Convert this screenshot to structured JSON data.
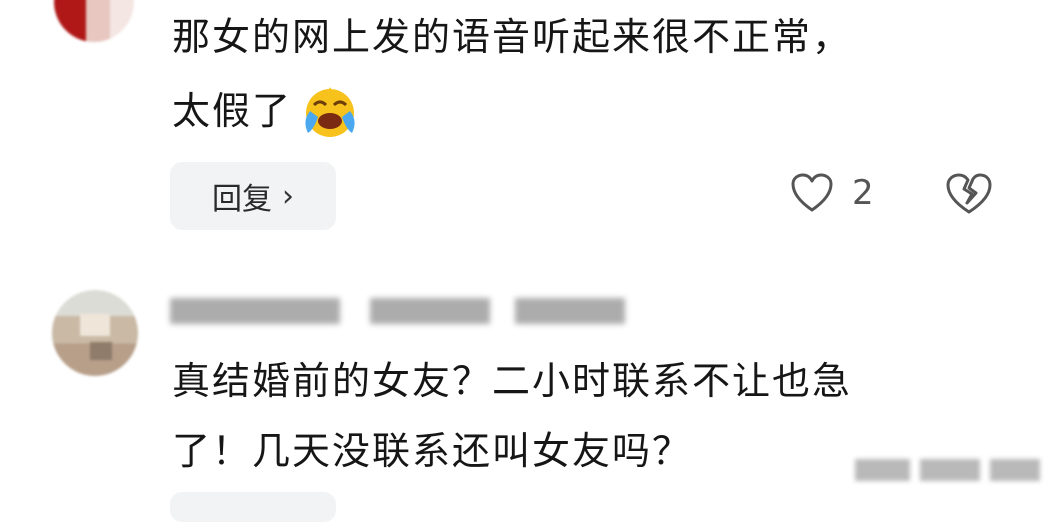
{
  "comment1": {
    "line1": "那女的网上发的语音听起来很不正常，",
    "line2": "太假了",
    "emoji": "crying-laughing-emoji",
    "reply_label": "回复",
    "like_count": "2"
  },
  "comment2": {
    "line1": "真结婚前的女友？二小时联系不让也急",
    "line2": "了！几天没联系还叫女友吗？"
  },
  "icons": {
    "like": "heart-icon",
    "dislike": "broken-heart-icon",
    "chevron": "chevron-right-icon"
  }
}
